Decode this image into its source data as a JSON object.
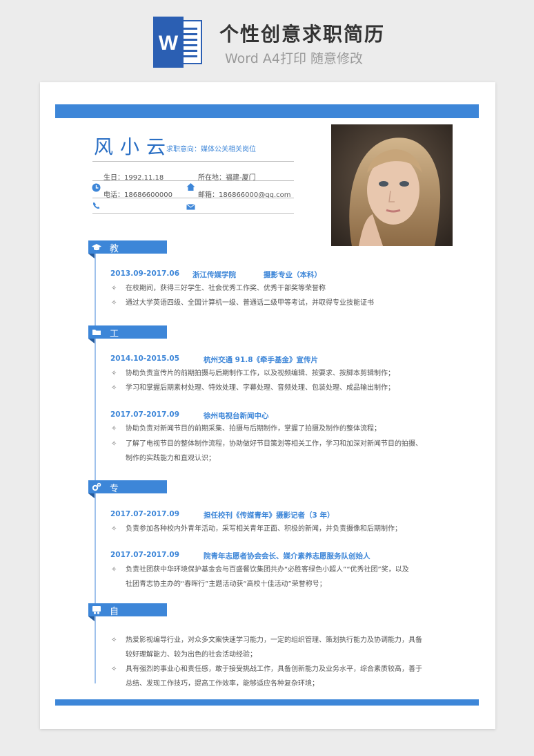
{
  "header": {
    "icon_letter": "W",
    "title": "个性创意求职简历",
    "subtitle": "Word A4打印 随意修改"
  },
  "profile": {
    "name": "风小云",
    "intent": "求职意向：媒体公关相关岗位",
    "birth": "生日：1992.11.18",
    "location": "所在地：福建-厦门",
    "phone": "电话：18686600000",
    "email": "邮箱：186866000@qq.com"
  },
  "sections": {
    "education": {
      "title": "教育背景",
      "date": "2013.09-2017.06",
      "school": "浙江传媒学院",
      "major": "摄影专业（本科）",
      "items": [
        "在校期间，获得三好学生、社会优秀工作奖、优秀干部奖等荣誉称",
        "通过大学英语四级、全国计算机一级、普通话二级甲等考试，并取得专业技能证书"
      ]
    },
    "work": {
      "title": "工作经验",
      "jobs": [
        {
          "date": "2014.10-2015.05",
          "org": "杭州交通 91.8《牵手基金》宣传片",
          "items": [
            "协助负责宣传片的前期拍摄与后期制作工作，以及视频编辑、按要求、按脚本剪辑制作；",
            "学习和掌握后期素材处理、特效处理、字幕处理、音频处理、包装处理、成品输出制作；"
          ]
        },
        {
          "date": "2017.07-2017.09",
          "org": "徐州电视台新闻中心",
          "items": [
            "协助负责对新闻节目的前期采集、拍摄与后期制作，掌握了拍摄及制作的整体流程；",
            "了解了电视节目的整体制作流程，协助做好节目策划等相关工作，学习和加深对新闻节目的拍摄、",
            "制作的实践能力和直观认识；"
          ]
        }
      ]
    },
    "skills": {
      "title": "专业技能",
      "entries": [
        {
          "date": "2017.07-2017.09",
          "org": "担任校刊《传媒青年》摄影记者（3 年）",
          "items": [
            "负责参加各种校内外青年活动，采写相关青年正面、积极的新闻，并负责摄像和后期制作；"
          ]
        },
        {
          "date": "2017.07-2017.09",
          "org": "院青年志愿者协会会长、媒介素养志愿服务队创始人",
          "items": [
            "负责社团获中华环境保护基金会与百盛餐饮集团共办“必胜客绿色小超人”“优秀社团”奖，以及",
            "社团青志协主办的“春晖行”主题活动获“高校十佳活动”荣誉称号；"
          ]
        }
      ]
    },
    "self": {
      "title": "自我评价",
      "items": [
        "热爱影视编导行业，对众多文案快速学习能力，一定的组织管理、策划执行能力及协调能力，具备",
        "较好理解能力、较为出色的社会活动经验；",
        "具有强烈的事业心和责任感，敢于接受挑战工作，具备创新能力及业务水平，综合素质较高，善于",
        "总结、发现工作技巧，提高工作效率，能够适应各种复杂环境；"
      ]
    }
  },
  "bullet_symbol": "✧",
  "colors": {
    "accent": "#3d86d8",
    "accent_dark": "#245a9c",
    "word_blue": "#2b5fb3"
  }
}
